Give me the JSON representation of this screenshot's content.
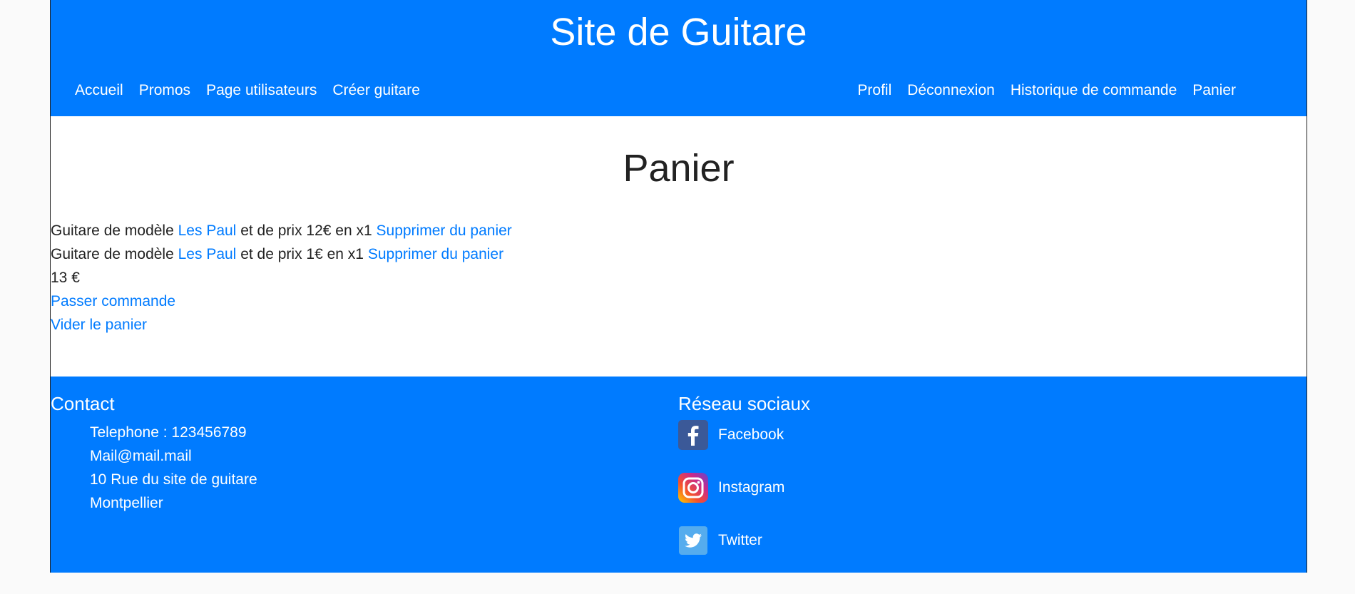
{
  "header": {
    "site_title": "Site de Guitare",
    "nav_left": [
      "Accueil",
      "Promos",
      "Page utilisateurs",
      "Créer guitare"
    ],
    "nav_right": [
      "Profil",
      "Déconnexion",
      "Historique de commande",
      "Panier"
    ]
  },
  "main": {
    "heading": "Panier",
    "cart_items": [
      {
        "prefix": "Guitare de modèle",
        "model": "Les Paul",
        "middle": "et de prix 12€ en x1",
        "remove": "Supprimer du panier"
      },
      {
        "prefix": "Guitare de modèle",
        "model": "Les Paul",
        "middle": "et de prix 1€ en x1",
        "remove": "Supprimer du panier"
      }
    ],
    "total": "13 €",
    "order_link": "Passer commande",
    "empty_link": "Vider le panier"
  },
  "footer": {
    "contact_heading": "Contact",
    "contact_lines": [
      "Telephone : 123456789",
      "Mail@mail.mail",
      "10 Rue du site de guitare",
      "Montpellier"
    ],
    "social_heading": "Réseau sociaux",
    "social": [
      {
        "label": "Facebook",
        "icon": "facebook-icon"
      },
      {
        "label": "Instagram",
        "icon": "instagram-icon"
      },
      {
        "label": "Twitter",
        "icon": "twitter-icon"
      }
    ]
  },
  "colors": {
    "brand": "#007bff",
    "text": "#222222",
    "link": "#007bff"
  }
}
